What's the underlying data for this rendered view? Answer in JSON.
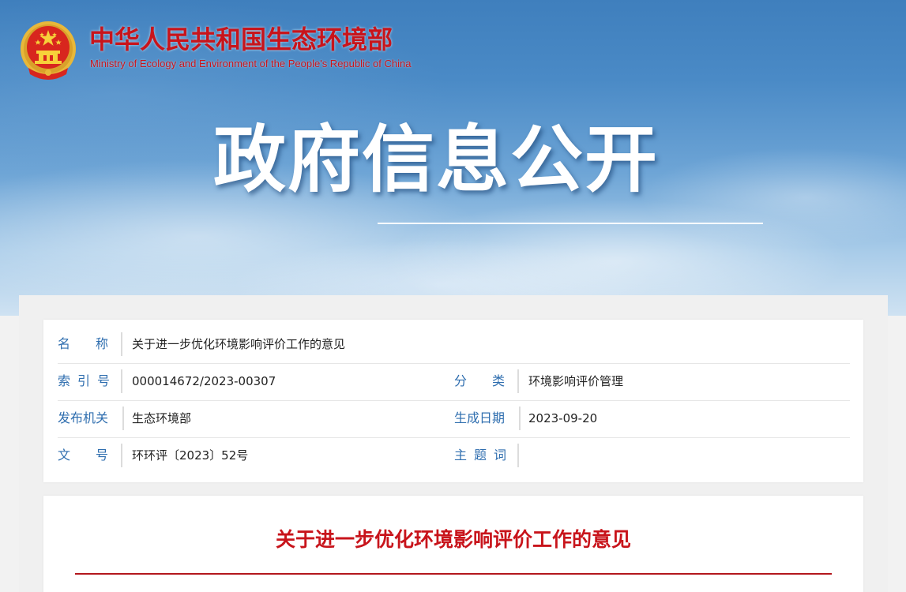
{
  "header": {
    "ministry_name_cn": "中华人民共和国生态环境部",
    "ministry_name_en": "Ministry of Ecology and Environment of the People's Republic of China",
    "emblem_icon": "national-emblem-icon",
    "banner_title": "政府信息公开"
  },
  "info_table": {
    "name": {
      "label_chars": [
        "名",
        "称"
      ],
      "value": "关于进一步优化环境影响评价工作的意见"
    },
    "index_no": {
      "label_chars": [
        "索",
        "引",
        "号"
      ],
      "value": "000014672/2023-00307"
    },
    "category": {
      "label_chars": [
        "分",
        "类"
      ],
      "value": "环境影响评价管理"
    },
    "issuer": {
      "label": "发布机关",
      "value": "生态环境部"
    },
    "date": {
      "label": "生成日期",
      "value": "2023-09-20"
    },
    "doc_no": {
      "label_chars": [
        "文",
        "号"
      ],
      "value": "环环评〔2023〕52号"
    },
    "keywords": {
      "label_chars": [
        "主",
        "题",
        "词"
      ],
      "value": ""
    }
  },
  "article": {
    "title": "关于进一步优化环境影响评价工作的意见"
  },
  "colors": {
    "brand_red": "#c8141b",
    "label_blue": "#2f6eaf",
    "sky_blue": "#4a8ac6"
  }
}
